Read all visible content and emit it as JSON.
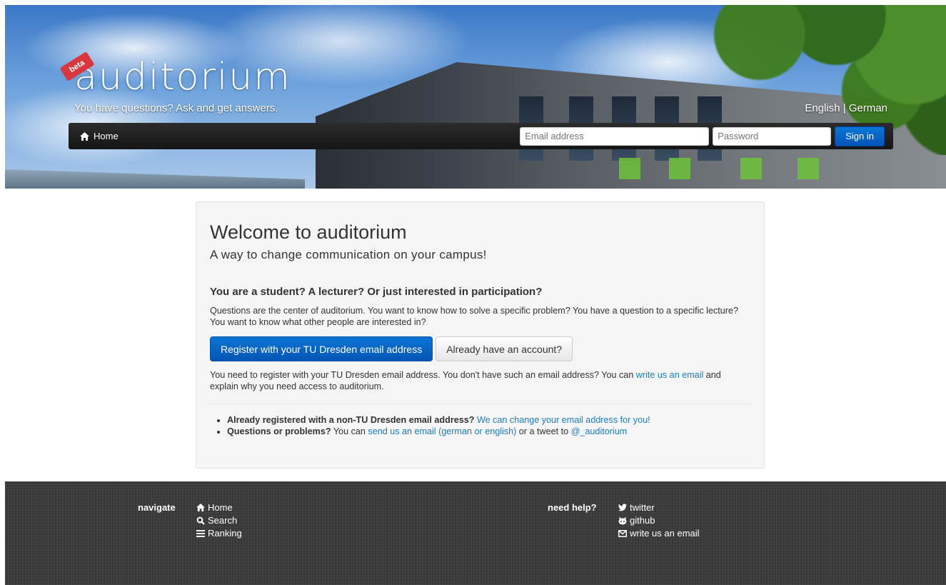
{
  "header": {
    "logo_badge": "beta",
    "logo_text": "auditorium",
    "tagline": "You have questions? Ask and get answers.",
    "lang_english": "English",
    "lang_separator": "|",
    "lang_german": "German"
  },
  "navbar": {
    "home_label": "Home",
    "email_placeholder": "Email address",
    "password_placeholder": "Password",
    "signin_label": "Sign in"
  },
  "main": {
    "title": "Welcome to auditorium",
    "subtitle": "A way to change communication on your campus!",
    "question_heading": "You are a student? A lecturer? Or just interested in participation?",
    "intro": "Questions are the center of auditorium. You want to know how to solve a specific problem? You have a question to a specific lecture? You want to know what other people are interested in?",
    "register_button": "Register with your TU Dresden email address",
    "account_button": "Already have an account?",
    "register_note_before": "You need to register with your TU Dresden email address. You don't have such an email address? You can ",
    "register_note_link": "write us an email",
    "register_note_after": " and explain why you need access to auditorium.",
    "bullets": [
      {
        "bold": "Already registered with a non-TU Dresden email address?",
        "text_before": " ",
        "link": "We can change your email address for you!",
        "text_mid": "",
        "link2": "",
        "text_after": ""
      },
      {
        "bold": "Questions or problems?",
        "text_before": " You can ",
        "link": "send us an email (german or english)",
        "text_mid": " or a tweet to ",
        "link2": "@_auditorium",
        "text_after": ""
      }
    ]
  },
  "footer": {
    "navigate_title": "navigate",
    "navigate_links": [
      {
        "label": "Home",
        "icon": "home-icon"
      },
      {
        "label": "Search",
        "icon": "search-icon"
      },
      {
        "label": "Ranking",
        "icon": "list-icon"
      }
    ],
    "help_title": "need help?",
    "help_links": [
      {
        "label": "twitter",
        "icon": "twitter-icon"
      },
      {
        "label": "github",
        "icon": "github-icon"
      },
      {
        "label": "write us an email",
        "icon": "envelope-icon"
      }
    ]
  },
  "colors": {
    "primary_button": "#0b75d4",
    "link": "#1a7ec2",
    "navbar": "#1f1f1f",
    "footer": "#3a3a3a",
    "card_bg": "#f5f5f5",
    "logo_badge": "#d9363e"
  }
}
